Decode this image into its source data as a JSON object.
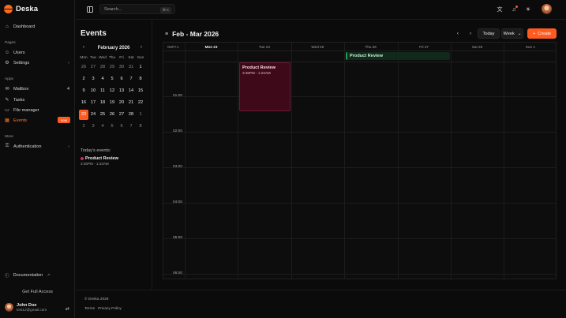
{
  "app": {
    "name": "Deska"
  },
  "sidebar": {
    "sections": [
      {
        "label": "Pages"
      },
      {
        "label": "Apps"
      },
      {
        "label": "More"
      }
    ],
    "dashboard": {
      "label": "Dashboard",
      "icon": "home-icon"
    },
    "pages": [
      {
        "label": "Users",
        "icon": "users-icon"
      },
      {
        "label": "Settings",
        "icon": "gear-icon",
        "chevron": "›"
      }
    ],
    "apps": [
      {
        "label": "Mailbox",
        "icon": "mail-icon",
        "count": "4"
      },
      {
        "label": "Tasks",
        "icon": "pencil-icon"
      },
      {
        "label": "File manager",
        "icon": "folder-icon"
      },
      {
        "label": "Events",
        "icon": "calendar-icon",
        "badge": "new",
        "active": true
      }
    ],
    "more": [
      {
        "label": "Authentication",
        "icon": "lock-icon",
        "chevron": "›"
      }
    ],
    "documentation": {
      "label": "Documentation",
      "ext": "↗"
    },
    "full_access": "Get Full Access",
    "user": {
      "name": "John Doe",
      "email": "test12@gmail.com"
    }
  },
  "topbar": {
    "search_placeholder": "Search...",
    "search_shortcut": "⌘ K"
  },
  "events_panel": {
    "title": "Events",
    "mini_calendar": {
      "month_label": "February 2026",
      "prev": "‹",
      "next": "›",
      "weekdays": [
        "Mon",
        "Tue",
        "Wed",
        "Thu",
        "Fri",
        "Sat",
        "Sun"
      ],
      "weeks": [
        [
          "26",
          "27",
          "28",
          "29",
          "30",
          "31",
          "1"
        ],
        [
          "2",
          "3",
          "4",
          "5",
          "6",
          "7",
          "8"
        ],
        [
          "9",
          "10",
          "11",
          "12",
          "13",
          "14",
          "15"
        ],
        [
          "16",
          "17",
          "18",
          "19",
          "20",
          "21",
          "22"
        ],
        [
          "23",
          "24",
          "25",
          "26",
          "27",
          "28",
          "1"
        ],
        [
          "2",
          "3",
          "4",
          "5",
          "6",
          "7",
          "8"
        ]
      ],
      "today": "23"
    },
    "today_label": "Today's events:",
    "today_events": [
      {
        "title": "Product Review",
        "time": "3:36PM - 1:23AM",
        "color": "#e0245e"
      }
    ]
  },
  "calendar": {
    "range_title": "Feb - Mar 2026",
    "prev": "‹",
    "next": "›",
    "today_label": "Today",
    "view_label": "Week",
    "view_chevron": "⌄",
    "create_label": "Create",
    "timezone": "GMT+1",
    "days": [
      "Mon 23",
      "Tue 24",
      "Wed 25",
      "Thu 26",
      "Fri 27",
      "Sat 28",
      "Sun 1"
    ],
    "current_day": "Mon 23",
    "hours": [
      "01:00",
      "02:00",
      "03:00",
      "04:00",
      "05:00",
      "06:00"
    ],
    "allday_event": {
      "title": "Product Review",
      "color": "#1f9a55"
    },
    "timed_event": {
      "title": "Product Review",
      "time": "3:36PM - 1:23AM",
      "color": "#6a1a30"
    }
  },
  "footer": {
    "copyright": "© Deska 2026",
    "links": [
      "Terms",
      "Privacy Policy"
    ]
  },
  "colors": {
    "accent": "#ff5a1f",
    "background": "#0b0b0b"
  }
}
